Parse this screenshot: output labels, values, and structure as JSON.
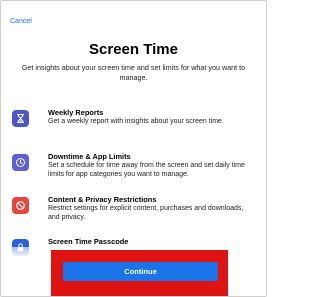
{
  "header": {
    "cancel_label": "Cancel"
  },
  "title": "Screen Time",
  "subtitle": "Get insights about your screen time and set limits for what you want to manage.",
  "features": [
    {
      "icon": "hourglass-icon",
      "heading": "Weekly Reports",
      "description": "Get a weekly report with insights about your screen time."
    },
    {
      "icon": "moon-clock-icon",
      "heading": "Downtime & App Limits",
      "description": "Set a schedule for time away from the screen and set daily time limits for app categories you want to manage."
    },
    {
      "icon": "restriction-icon",
      "heading": "Content & Privacy Restrictions",
      "description": "Restrict settings for explicit content, purchases and downloads, and privacy."
    },
    {
      "icon": "lock-icon",
      "heading": "Screen Time Passcode",
      "description": ""
    }
  ],
  "footer": {
    "continue_label": "Continue"
  },
  "colors": {
    "accent": "#1a73e8",
    "highlight_frame": "#e01313",
    "icon_weekly": "#4b56c9",
    "icon_downtime": "#5e5fd0",
    "icon_restrictions": "#e9443b",
    "icon_passcode": "#2f5fd8"
  }
}
